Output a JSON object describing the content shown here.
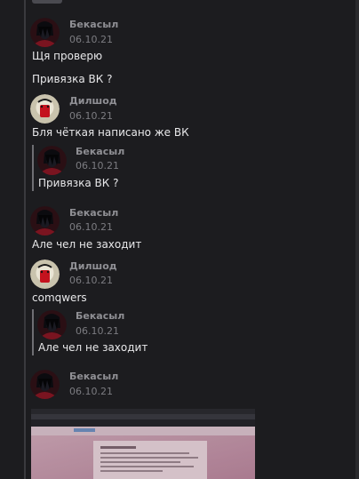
{
  "messages": [
    {
      "author": "Бекасыл",
      "date": "06.10.21",
      "texts": [
        "Щя проверю",
        "Привязка ВК ?"
      ],
      "avatar": "dark-character-avatar"
    },
    {
      "author": "Дилшод",
      "date": "06.10.21",
      "text": "Бля чёткая написано же ВК",
      "avatar": "cartoon-red-avatar",
      "quote": {
        "author": "Бекасыл",
        "date": "06.10.21",
        "text": "Привязка ВК ?"
      }
    },
    {
      "author": "Бекасыл",
      "date": "06.10.21",
      "text": "Але чел не заходит",
      "avatar": "dark-character-avatar"
    },
    {
      "author": "Дилшод",
      "date": "06.10.21",
      "text": "comqwers",
      "avatar": "cartoon-red-avatar",
      "quote": {
        "author": "Бекасыл",
        "date": "06.10.21",
        "text": "Але чел не заходит"
      }
    },
    {
      "author": "Бекасыл",
      "date": "06.10.21",
      "avatar": "dark-character-avatar",
      "attachment": "photo-of-laptop-screen"
    }
  ],
  "colors": {
    "background": "#1c1c1f",
    "name": "#8f8f94",
    "date": "#7c7c81",
    "text": "#e8e8ea",
    "quote_bar": "#6e6e73"
  }
}
